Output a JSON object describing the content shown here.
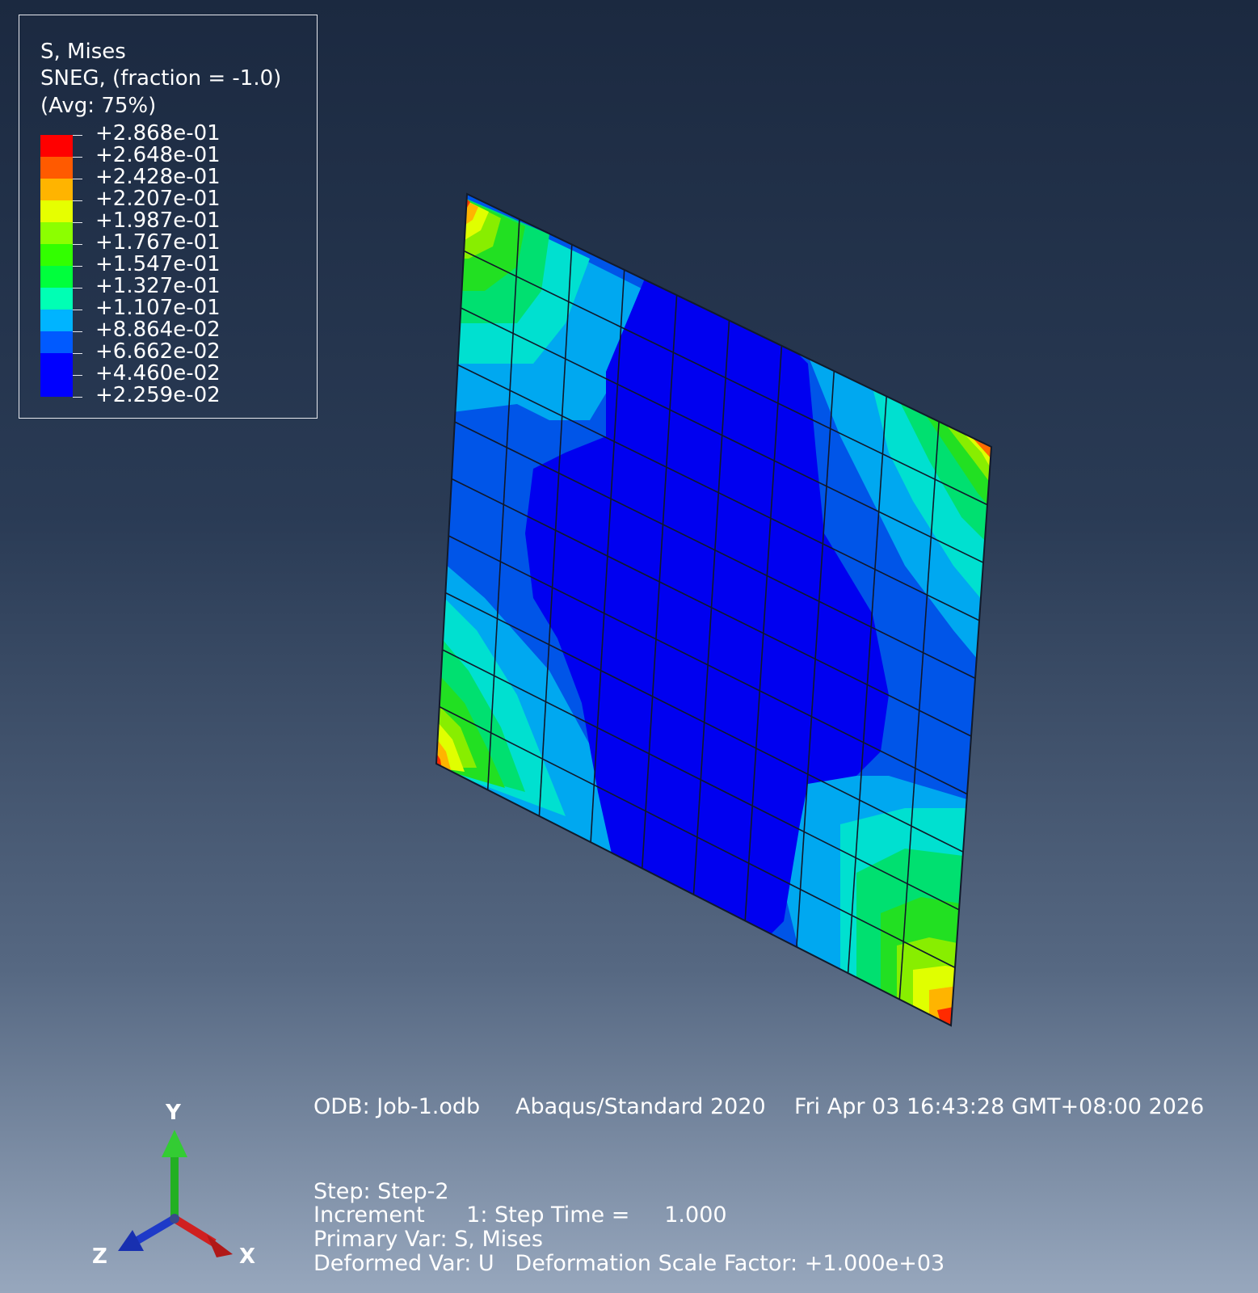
{
  "legend": {
    "title": "S, Mises",
    "subtitle1": "SNEG, (fraction = -1.0)",
    "subtitle2": "(Avg: 75%)",
    "values": [
      "+2.868e-01",
      "+2.648e-01",
      "+2.428e-01",
      "+2.207e-01",
      "+1.987e-01",
      "+1.767e-01",
      "+1.547e-01",
      "+1.327e-01",
      "+1.107e-01",
      "+8.864e-02",
      "+6.662e-02",
      "+4.460e-02",
      "+2.259e-02"
    ],
    "colors": [
      "#ff0000",
      "#ff5a00",
      "#ffb400",
      "#e6ff00",
      "#8cff00",
      "#32ff00",
      "#00ff3c",
      "#00ffb4",
      "#00b4ff",
      "#005aff",
      "#0000ff",
      "#0000ff"
    ]
  },
  "info": {
    "line1_odb": "ODB: Job-1.odb",
    "line1_solver": "Abaqus/Standard 2020",
    "line1_date": "Fri Apr 03 16:43:28 GMT+08:00 2026",
    "step": "Step: Step-2",
    "increment": "Increment      1: Step Time =     1.000",
    "primary_var": "Primary Var: S, Mises",
    "deformed_var": "Deformed Var: U   Deformation Scale Factor: +1.000e+03"
  },
  "triad": {
    "y_label": "Y",
    "z_label": "Z",
    "x_label": "X",
    "y_color": "#22b022",
    "z_color": "#1e3ac8",
    "x_color": "#d02020"
  }
}
